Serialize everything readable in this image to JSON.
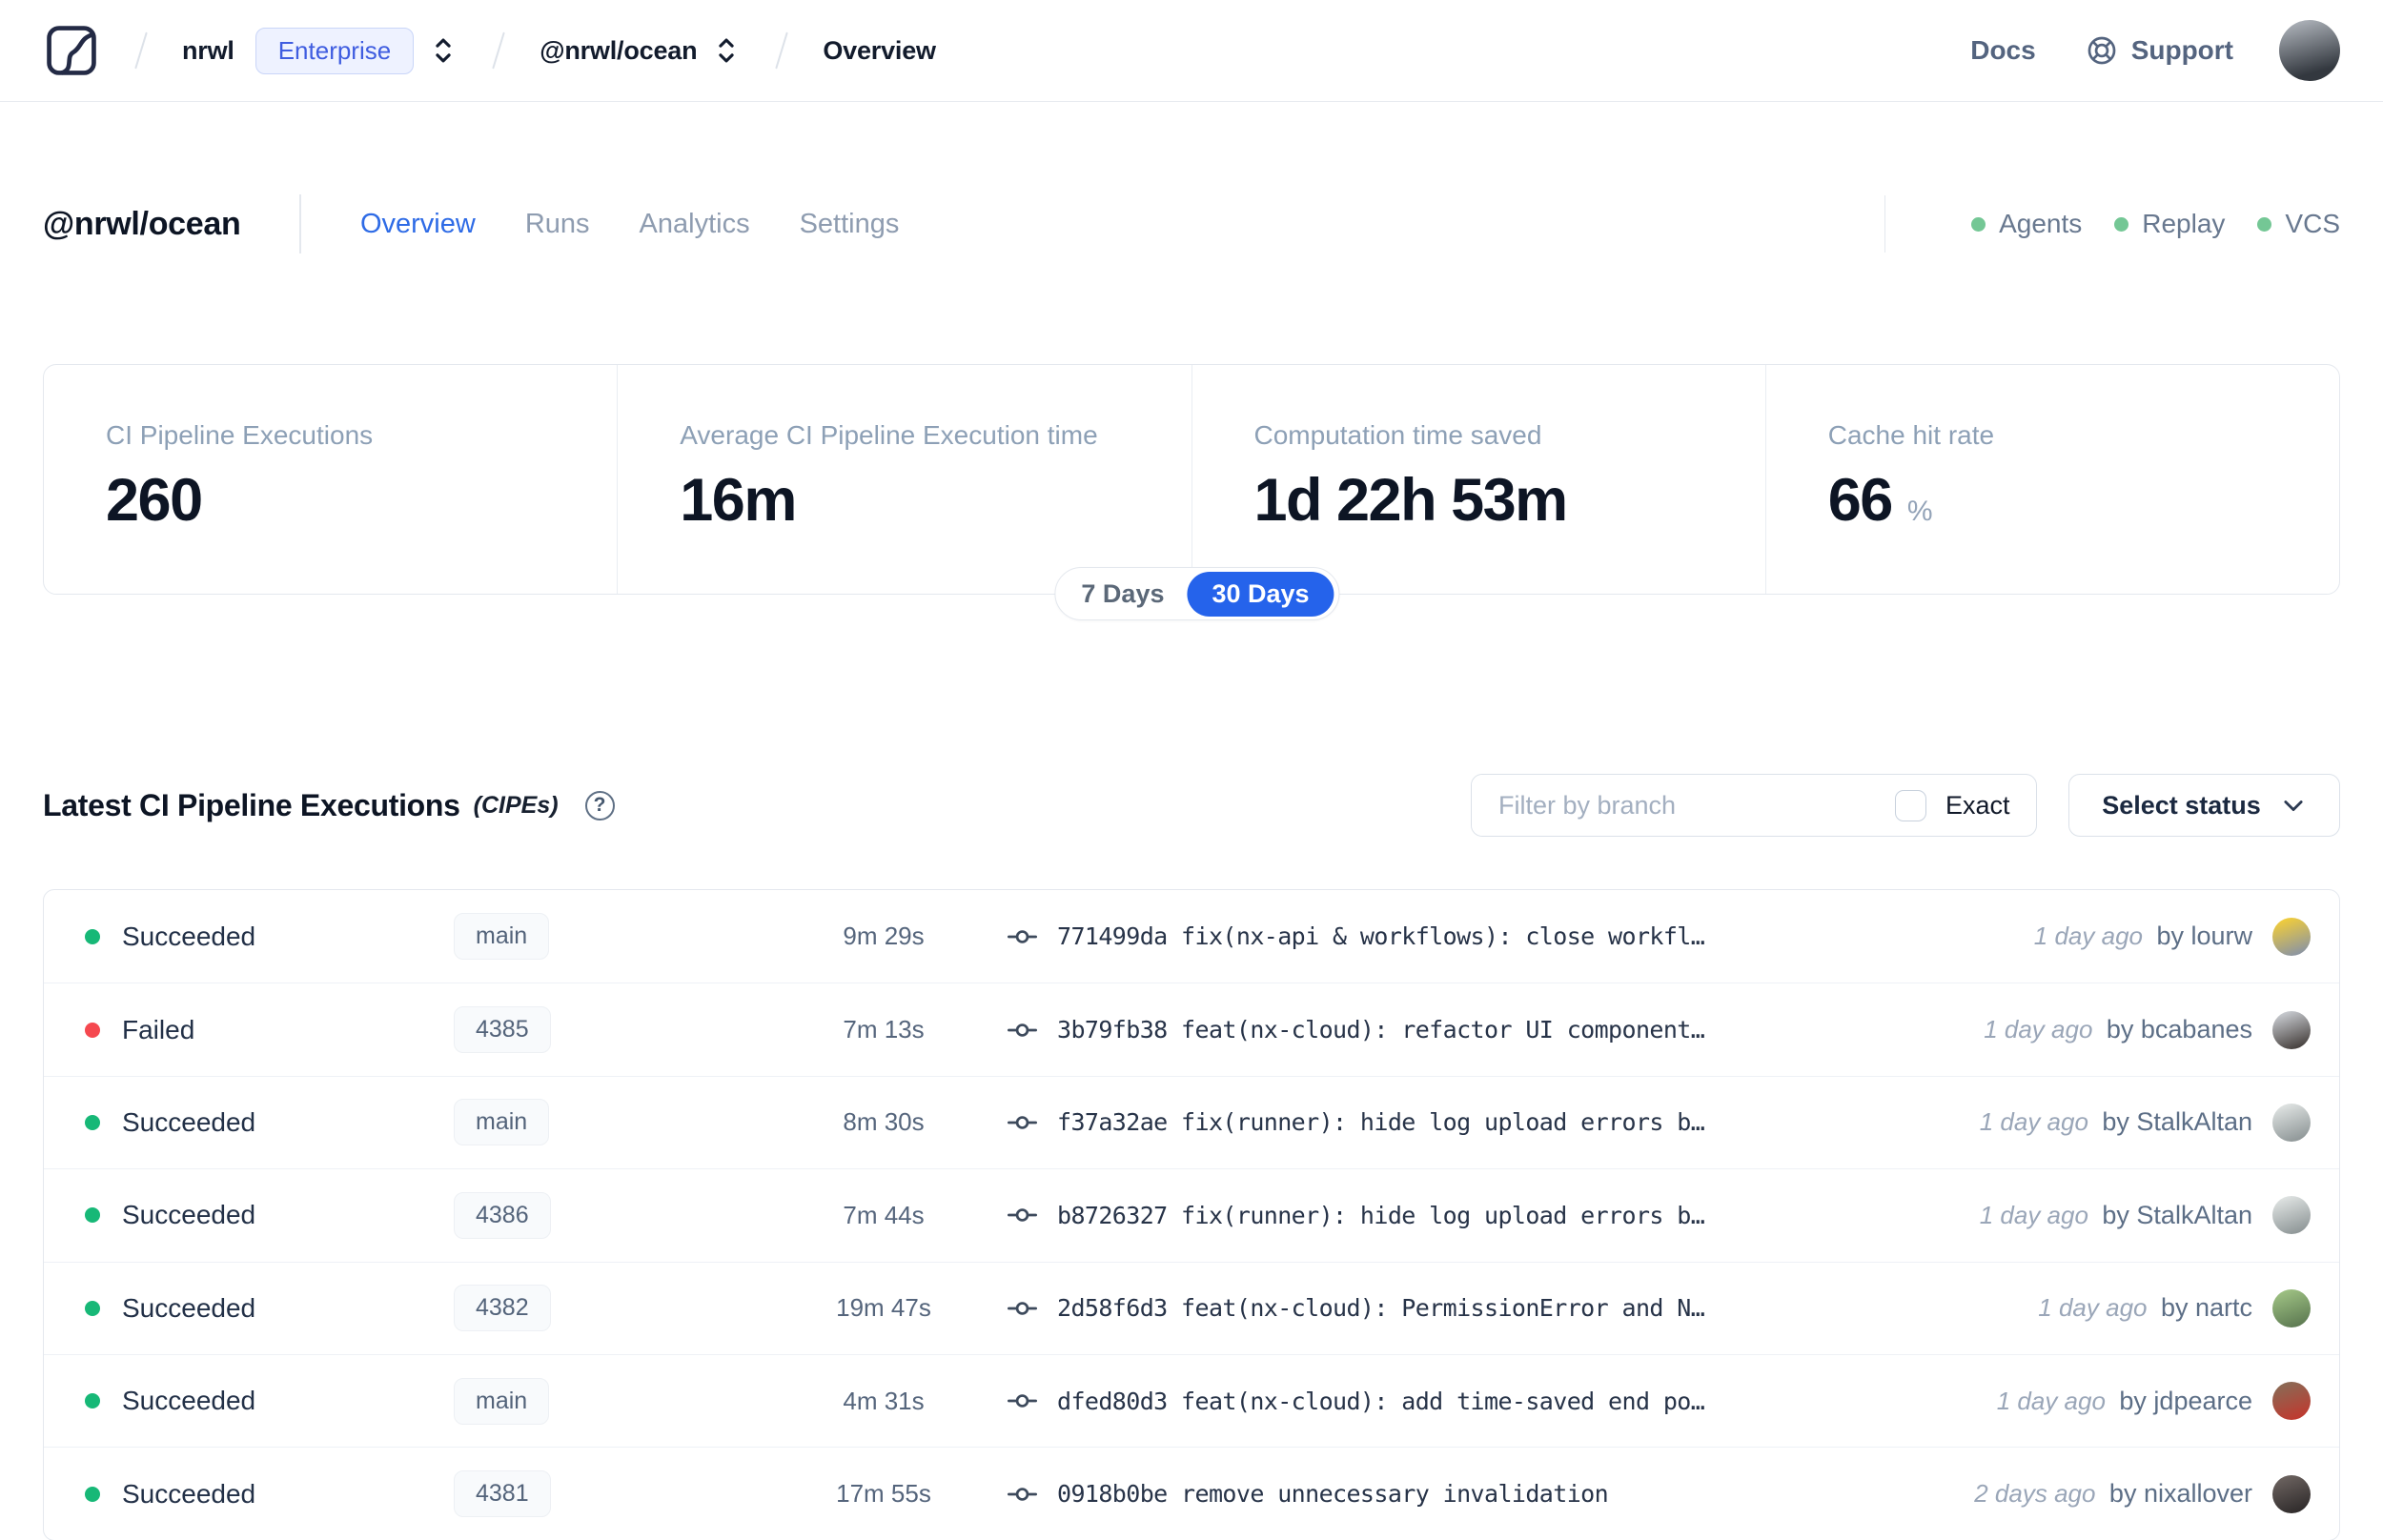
{
  "colors": {
    "accent_blue": "#2563eb",
    "active_tab_blue": "#2e6be6",
    "succeeded": "#17b877",
    "failed": "#f5484f",
    "indicator_green": "#74c795"
  },
  "nav": {
    "org": "nrwl",
    "org_badge": "Enterprise",
    "workspace": "@nrwl/ocean",
    "page": "Overview",
    "docs": "Docs",
    "support": "Support",
    "avatar_colors": [
      "#b9bec5",
      "#33383f"
    ]
  },
  "header": {
    "title": "@nrwl/ocean",
    "tabs": [
      {
        "label": "Overview",
        "active": true
      },
      {
        "label": "Runs",
        "active": false
      },
      {
        "label": "Analytics",
        "active": false
      },
      {
        "label": "Settings",
        "active": false
      }
    ],
    "indicators": [
      {
        "label": "Agents"
      },
      {
        "label": "Replay"
      },
      {
        "label": "VCS"
      }
    ]
  },
  "stats": {
    "cards": [
      {
        "label": "CI Pipeline Executions",
        "value": "260",
        "suffix": ""
      },
      {
        "label": "Average CI Pipeline Execution time",
        "value": "16m",
        "suffix": ""
      },
      {
        "label": "Computation time saved",
        "value": "1d 22h 53m",
        "suffix": ""
      },
      {
        "label": "Cache hit rate",
        "value": "66",
        "suffix": "%"
      }
    ],
    "period_toggle": {
      "options": [
        "7 Days",
        "30 Days"
      ],
      "selected": "30 Days"
    }
  },
  "cipe_section": {
    "title": "Latest CI Pipeline Executions",
    "title_suffix": "(CIPEs)",
    "help_glyph": "?",
    "filter_placeholder": "Filter by branch",
    "exact_label": "Exact",
    "status_dropdown_label": "Select status",
    "rows": [
      {
        "status": "Succeeded",
        "branch": "main",
        "duration": "9m 29s",
        "commit": "771499da fix(nx-api & workflows): close workfl…",
        "time": "1 day ago",
        "author": "by lourw",
        "avatar_colors": [
          "#f2cd3a",
          "#8a94a3"
        ]
      },
      {
        "status": "Failed",
        "branch": "4385",
        "duration": "7m 13s",
        "commit": "3b79fb38 feat(nx-cloud): refactor UI component…",
        "time": "1 day ago",
        "author": "by bcabanes",
        "avatar_colors": [
          "#c9ccd1",
          "#453f3c"
        ]
      },
      {
        "status": "Succeeded",
        "branch": "main",
        "duration": "8m 30s",
        "commit": "f37a32ae fix(runner): hide log upload errors b…",
        "time": "1 day ago",
        "author": "by StalkAltan",
        "avatar_colors": [
          "#dfe3e2",
          "#8e9697"
        ]
      },
      {
        "status": "Succeeded",
        "branch": "4386",
        "duration": "7m 44s",
        "commit": "b8726327 fix(runner): hide log upload errors b…",
        "time": "1 day ago",
        "author": "by StalkAltan",
        "avatar_colors": [
          "#dfe3e2",
          "#8e9697"
        ]
      },
      {
        "status": "Succeeded",
        "branch": "4382",
        "duration": "19m 47s",
        "commit": "2d58f6d3 feat(nx-cloud): PermissionError and N…",
        "time": "1 day ago",
        "author": "by nartc",
        "avatar_colors": [
          "#9ec183",
          "#5d7a52"
        ]
      },
      {
        "status": "Succeeded",
        "branch": "main",
        "duration": "4m 31s",
        "commit": "dfed80d3 feat(nx-cloud): add time-saved end po…",
        "time": "1 day ago",
        "author": "by jdpearce",
        "avatar_colors": [
          "#8a6a55",
          "#c0392f"
        ]
      },
      {
        "status": "Succeeded",
        "branch": "4381",
        "duration": "17m 55s",
        "commit": "0918b0be remove unnecessary invalidation",
        "time": "2 days ago",
        "author": "by nixallover",
        "avatar_colors": [
          "#6b625f",
          "#2f2b2b"
        ]
      }
    ]
  }
}
